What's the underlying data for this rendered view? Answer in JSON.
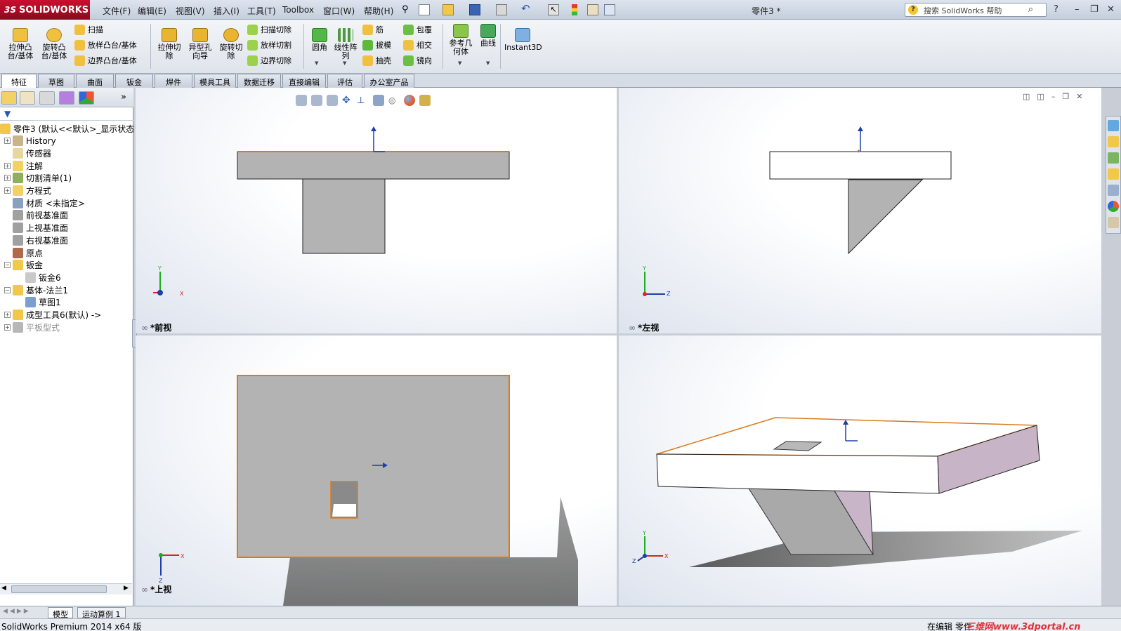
{
  "app": {
    "logo_text": "SOLIDWORKS",
    "logo_ds": "3S",
    "document_title": "零件3 *",
    "search_placeholder": "搜索 SolidWorks 帮助"
  },
  "menu": [
    "文件(F)",
    "编辑(E)",
    "视图(V)",
    "插入(I)",
    "工具(T)",
    "Toolbox",
    "窗口(W)",
    "帮助(H)"
  ],
  "ribbon": {
    "big_tools": [
      {
        "label": "拉伸凸\n台/基体",
        "icon": "extrude-boss-icon"
      },
      {
        "label": "旋转凸\n台/基体",
        "icon": "revolve-boss-icon"
      },
      {
        "label": "拉伸切\n除",
        "icon": "extrude-cut-icon"
      },
      {
        "label": "异型孔\n向导",
        "icon": "hole-wizard-icon"
      },
      {
        "label": "旋转切\n除",
        "icon": "revolve-cut-icon"
      },
      {
        "label": "圆角",
        "icon": "fillet-icon"
      },
      {
        "label": "线性阵\n列",
        "icon": "linear-pattern-icon"
      },
      {
        "label": "参考几\n何体",
        "icon": "reference-geometry-icon"
      },
      {
        "label": "曲线",
        "icon": "curves-icon"
      },
      {
        "label": "Instant3D",
        "icon": "instant3d-icon"
      }
    ],
    "small_tools": [
      {
        "label": "扫描",
        "icon": "sweep-icon"
      },
      {
        "label": "放样凸台/基体",
        "icon": "loft-icon"
      },
      {
        "label": "边界凸台/基体",
        "icon": "boundary-boss-icon"
      },
      {
        "label": "扫描切除",
        "icon": "swept-cut-icon"
      },
      {
        "label": "放样切割",
        "icon": "lofted-cut-icon"
      },
      {
        "label": "边界切除",
        "icon": "boundary-cut-icon"
      },
      {
        "label": "筋",
        "icon": "rib-icon"
      },
      {
        "label": "拔模",
        "icon": "draft-icon"
      },
      {
        "label": "抽壳",
        "icon": "shell-icon"
      },
      {
        "label": "包覆",
        "icon": "wrap-icon"
      },
      {
        "label": "相交",
        "icon": "intersect-icon"
      },
      {
        "label": "镜向",
        "icon": "mirror-icon"
      }
    ]
  },
  "tabs": [
    "特征",
    "草图",
    "曲面",
    "钣金",
    "焊件",
    "模具工具",
    "数据迁移",
    "直接编辑",
    "评估",
    "办公室产品"
  ],
  "feature_tree": [
    {
      "label": "零件3 (默认<<默认>_显示状态",
      "icon": "part-icon"
    },
    {
      "label": "History",
      "icon": "history-icon"
    },
    {
      "label": "传感器",
      "icon": "sensor-icon"
    },
    {
      "label": "注解",
      "icon": "annotation-icon"
    },
    {
      "label": "切割清单(1)",
      "icon": "cut-list-icon"
    },
    {
      "label": "方程式",
      "icon": "equation-icon"
    },
    {
      "label": "材质 <未指定>",
      "icon": "material-icon"
    },
    {
      "label": "前视基准面",
      "icon": "plane-icon"
    },
    {
      "label": "上视基准面",
      "icon": "plane-icon"
    },
    {
      "label": "右视基准面",
      "icon": "plane-icon"
    },
    {
      "label": "原点",
      "icon": "origin-icon"
    },
    {
      "label": "钣金",
      "icon": "sheet-metal-icon"
    },
    {
      "label": "钣金6",
      "icon": "sheet-metal-feature-icon"
    },
    {
      "label": "基体-法兰1",
      "icon": "base-flange-icon"
    },
    {
      "label": "草图1",
      "icon": "sketch-icon"
    },
    {
      "label": "成型工具6(默认) ->",
      "icon": "forming-tool-icon"
    },
    {
      "label": "平板型式",
      "icon": "flat-pattern-icon"
    }
  ],
  "views": {
    "front": "*前视",
    "left": "*左视",
    "top": "*上视"
  },
  "bottom_tabs": [
    "模型",
    "运动算例 1"
  ],
  "status": {
    "left": "SolidWorks Premium 2014 x64 版",
    "right": "在编辑 零件",
    "watermark": "三维网www.3dportal.cn"
  },
  "colors": {
    "accent_edge": "#d97a1c",
    "face_grey": "#b4b4b4",
    "face_white": "#ffffff",
    "face_pink": "#c7b4c6",
    "logo_red": "#c8102e"
  }
}
